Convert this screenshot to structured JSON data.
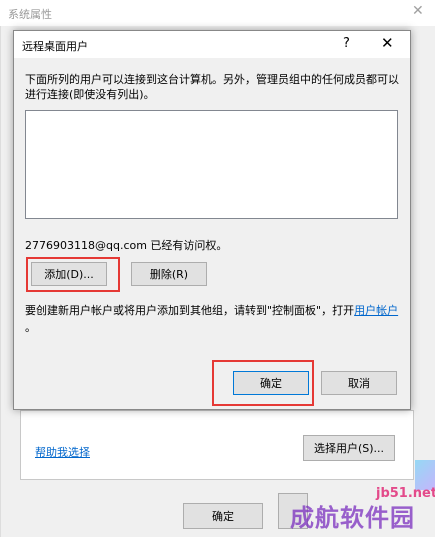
{
  "background_window": {
    "title": "系统属性",
    "help_link": "帮助我选择",
    "select_users_button": "选择用户(S)...",
    "ok_button": "确定"
  },
  "dialog": {
    "title": "远程桌面用户",
    "help_glyph": "?",
    "close_glyph": "✕",
    "description": "下面所列的用户可以连接到这台计算机。另外，管理员组中的任何成员都可以进行连接(即使没有列出)。",
    "users": [],
    "access_note": "2776903118@qq.com 已经有访问权。",
    "add_button": "添加(D)...",
    "remove_button": "删除(R)",
    "info_text": "要创建新用户帐户或将用户添加到其他组，请转到\"控制面板\"，打开",
    "info_link": "用户帐户",
    "info_tail": "。",
    "ok_button": "确定",
    "cancel_button": "取消"
  },
  "annotations": {
    "highlight_color": "#e53935"
  },
  "watermark": {
    "domain": "jb51.net",
    "name": "成航软件园"
  }
}
